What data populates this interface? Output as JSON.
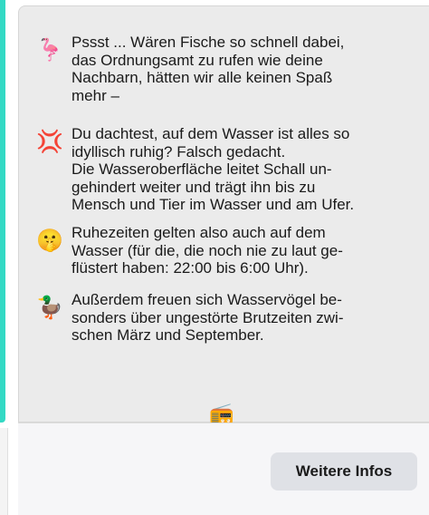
{
  "paragraphs": [
    {
      "icon": "flamingo-float-icon",
      "emoji": "🦩",
      "text": "Pssst ... Wären Fische so schnell dabei,\ndas Ordnungsamt zu rufen wie deine\nNachbarn, hätten wir alle keinen Spaß\nmehr –"
    },
    {
      "icon": "anger-symbol-icon",
      "emoji": "💢",
      "text": "Du dachtest, auf dem Wasser ist alles so\nidyllisch ruhig? Falsch gedacht.\nDie Wasseroberfläche leitet Schall un-\ngehindert weiter und trägt ihn bis zu\nMensch und Tier im Wasser und am Ufer."
    },
    {
      "icon": "shushing-face-icon",
      "emoji": "🤫",
      "text": "Ruhezeiten gelten also auch auf dem\nWasser (für die, die noch nie zu laut ge-\nflüstert haben: 22:00 bis 6:00 Uhr)."
    },
    {
      "icon": "duck-icon",
      "emoji": "🦆",
      "text": "Außerdem freuen sich Wasservögel be-\nsonders über ungestörte Brutzeiten zwi-\nschen März und September."
    }
  ],
  "bottom_icon": {
    "icon": "boombox-icon",
    "emoji": "📻"
  },
  "footer": {
    "more_info_label": "Weitere Infos"
  },
  "colors": {
    "accent": "#33d9c4",
    "card_bg": "#ebebeb",
    "button_bg": "#dfe1e6"
  }
}
